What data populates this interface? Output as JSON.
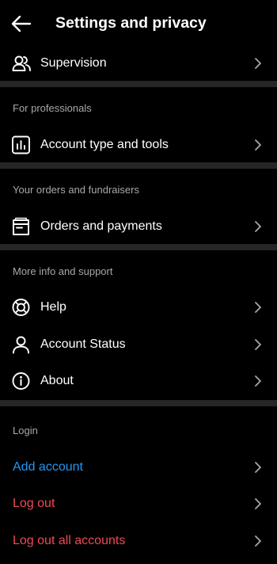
{
  "header": {
    "title": "Settings and privacy",
    "back_icon": "arrow-left-icon"
  },
  "rows": {
    "supervision": {
      "label": "Supervision",
      "icon": "people-icon"
    },
    "account_type": {
      "label": "Account type and tools",
      "icon": "bar-chart-icon"
    },
    "orders": {
      "label": "Orders and payments",
      "icon": "receipt-icon"
    },
    "help": {
      "label": "Help",
      "icon": "lifebuoy-icon"
    },
    "account_status": {
      "label": "Account Status",
      "icon": "person-icon"
    },
    "about": {
      "label": "About",
      "icon": "info-icon"
    },
    "add_account": {
      "label": "Add account"
    },
    "log_out": {
      "label": "Log out"
    },
    "log_out_all": {
      "label": "Log out all accounts"
    }
  },
  "sections": {
    "professionals": "For professionals",
    "orders": "Your orders and fundraisers",
    "support": "More info and support",
    "login": "Login"
  },
  "colors": {
    "background": "#000000",
    "divider": "#262626",
    "section_text": "#a8a8a8",
    "link_blue": "#2196f3",
    "danger_red": "#ed4956"
  }
}
